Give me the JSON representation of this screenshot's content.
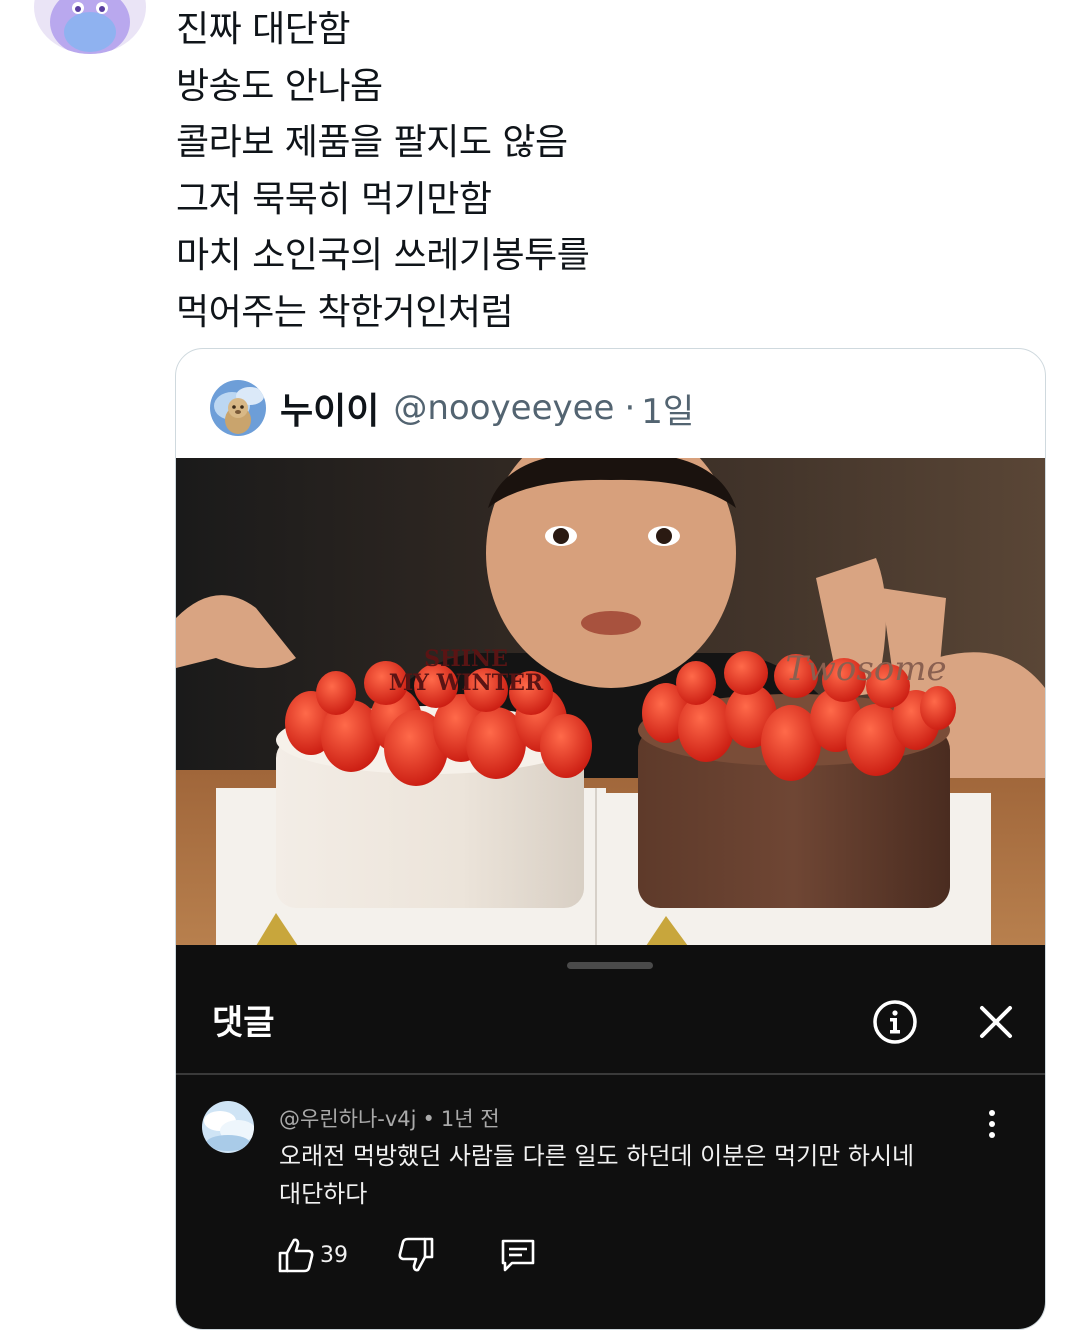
{
  "tweet": {
    "lines": [
      "진짜 대단함",
      "방송도 안나옴",
      "콜라보 제품을 팔지도 않음",
      "그저 묵묵히 먹기만함",
      "마치 소인국의 쓰레기봉투를",
      "먹어주는 착한거인처럼"
    ]
  },
  "quote": {
    "name": "누이이",
    "handle": "@nooyeeyee",
    "separator": "·",
    "time": "1일"
  },
  "media": {
    "cake_left_topper": [
      "SHINE",
      "MY WINTER"
    ],
    "cake_right_topper": "Twosome"
  },
  "youtube_panel": {
    "title": "댓글",
    "comment": {
      "author": "@우린하나-v4j",
      "dot": "•",
      "time": "1년 전",
      "text_lines": [
        "오래전 먹방했던 사람들 다른 일도 하던데 이분은 먹기만 하시네",
        "대단하다"
      ],
      "likes": "39"
    }
  }
}
